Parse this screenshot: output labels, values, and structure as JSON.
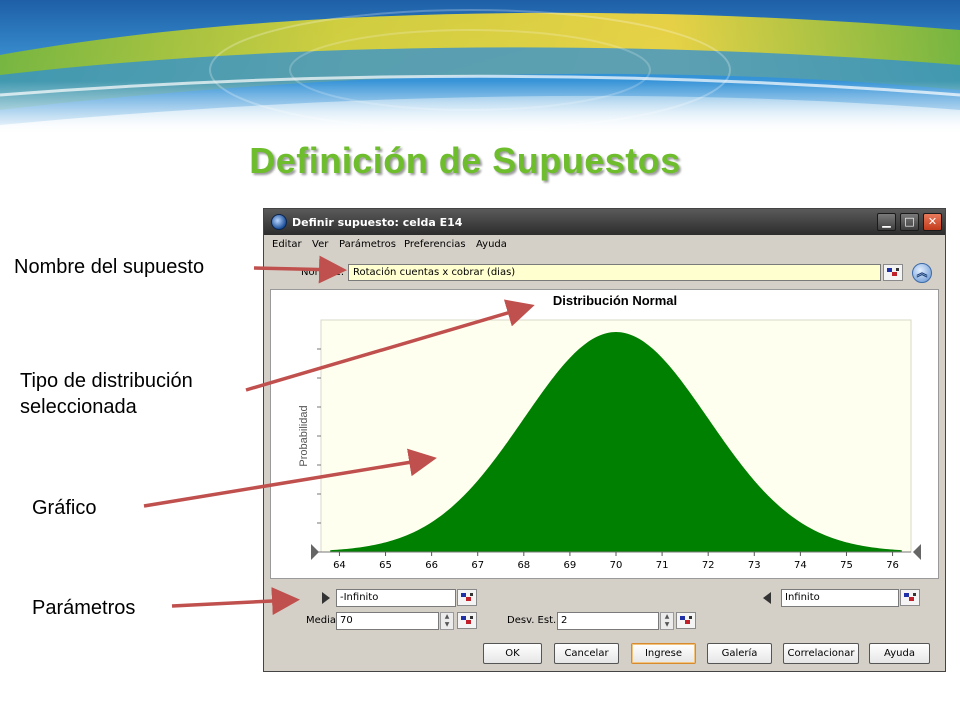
{
  "slide": {
    "title": "Definición de Supuestos",
    "callouts": {
      "name": "Nombre del supuesto",
      "distribution": "Tipo de distribución seleccionada",
      "graph": "Gráfico",
      "parameters": "Parámetros"
    },
    "arrow_color": "#c0504d",
    "title_color": "#6dbd2c"
  },
  "dialog": {
    "title": "Definir supuesto: celda E14",
    "window_buttons": [
      "minimize-icon",
      "maximize-icon",
      "close-icon"
    ],
    "menu": [
      "Editar",
      "Ver",
      "Parámetros",
      "Preferencias",
      "Ayuda"
    ],
    "name_label": "Nombre:",
    "name_value": "Rotación cuentas x cobrar (dias)",
    "buttons": [
      "OK",
      "Cancelar",
      "Ingrese",
      "Galería",
      "Correlacionar",
      "Ayuda"
    ],
    "params": {
      "left_bound": "-Infinito",
      "right_bound": "Infinito",
      "media_label": "Media",
      "media_value": "70",
      "desv_label": "Desv. Est.",
      "desv_value": "2"
    }
  },
  "chart_data": {
    "type": "area",
    "title": "Distribución Normal",
    "ylabel": "Probabilidad",
    "xlabel": "",
    "x_ticks": [
      64,
      65,
      66,
      67,
      68,
      69,
      70,
      71,
      72,
      73,
      74,
      75,
      76
    ],
    "xlim": [
      63.6,
      76.4
    ],
    "distribution": {
      "name": "normal",
      "mean": 70,
      "std": 2
    },
    "fill_color": "#008000",
    "background": "#fffff0"
  }
}
